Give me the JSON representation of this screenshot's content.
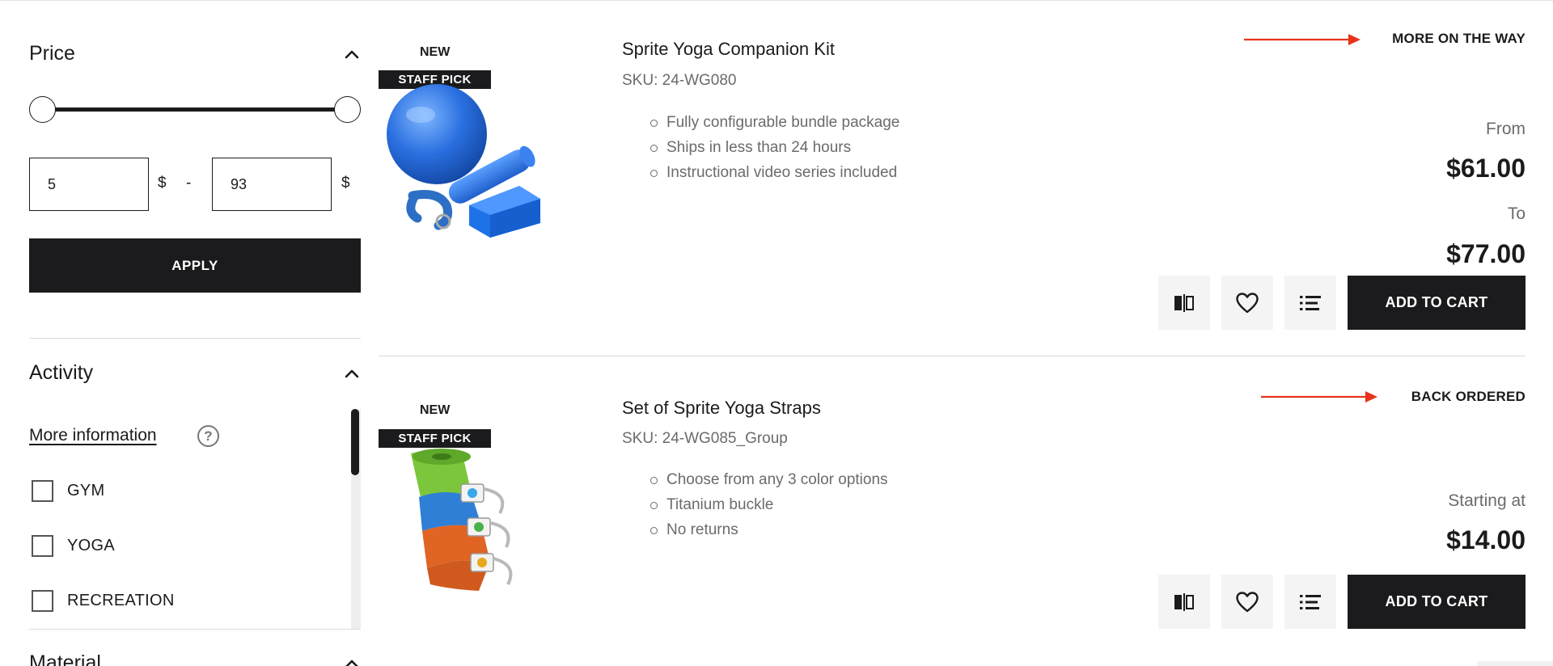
{
  "filters": {
    "price": {
      "title": "Price",
      "min_value": "5",
      "max_value": "93",
      "currency": "$",
      "separator": "-",
      "apply_label": "APPLY"
    },
    "activity": {
      "title": "Activity",
      "more_info": "More information",
      "help": "?",
      "options": [
        "GYM",
        "YOGA",
        "RECREATION"
      ]
    },
    "material": {
      "title": "Material"
    }
  },
  "products": [
    {
      "badge_new": "NEW",
      "badge_staff": "STAFF PICK",
      "name": "Sprite Yoga Companion Kit",
      "sku": "SKU: 24-WG080",
      "features": [
        "Fully configurable bundle package",
        "Ships in less than 24 hours",
        "Instructional video series included"
      ],
      "stock": "MORE ON THE WAY",
      "price_from_label": "From",
      "price_from": "$61.00",
      "price_to_label": "To",
      "price_to": "$77.00",
      "cart_label": "ADD TO CART"
    },
    {
      "badge_new": "NEW",
      "badge_staff": "STAFF PICK",
      "name": "Set of Sprite Yoga Straps",
      "sku": "SKU: 24-WG085_Group",
      "features": [
        "Choose from any 3 color options",
        "Titanium buckle",
        "No returns"
      ],
      "stock": "BACK ORDERED",
      "price_label": "Starting at",
      "price": "$14.00",
      "cart_label": "ADD TO CART"
    }
  ],
  "colors": {
    "primary": "#1b1b1d",
    "muted_text": "#6b6b6b",
    "arrow": "#e8331c",
    "icon_button_bg": "#f4f4f4"
  },
  "icons": [
    "chevron-up-icon",
    "help-circle-icon",
    "compare-icon",
    "heart-icon",
    "list-icon"
  ]
}
